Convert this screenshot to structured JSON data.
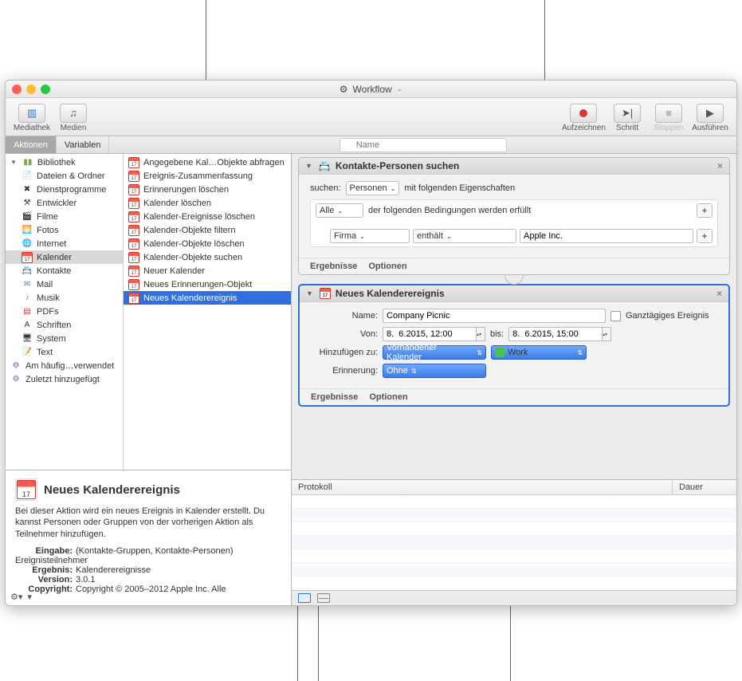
{
  "window": {
    "title": "Workflow"
  },
  "toolbar": {
    "mediathek": "Mediathek",
    "medien": "Medien",
    "aufzeichnen": "Aufzeichnen",
    "schritt": "Schritt",
    "stoppen": "Stoppen",
    "ausfuehren": "Ausführen"
  },
  "subtabs": {
    "aktionen": "Aktionen",
    "variablen": "Variablen",
    "search_placeholder": "Name"
  },
  "categories": {
    "bibliothek": "Bibliothek",
    "items": [
      "Dateien & Ordner",
      "Dienstprogramme",
      "Entwickler",
      "Filme",
      "Fotos",
      "Internet",
      "Kalender",
      "Kontakte",
      "Mail",
      "Musik",
      "PDFs",
      "Schriften",
      "System",
      "Text"
    ],
    "am_haeufig": "Am häufig…verwendet",
    "zuletzt": "Zuletzt hinzugefügt"
  },
  "actions": [
    "Angegebene Kal…Objekte abfragen",
    "Ereignis-Zusammenfassung",
    "Erinnerungen löschen",
    "Kalender löschen",
    "Kalender-Ereignisse löschen",
    "Kalender-Objekte filtern",
    "Kalender-Objekte löschen",
    "Kalender-Objekte suchen",
    "Neuer Kalender",
    "Neues Erinnerungen-Objekt",
    "Neues Kalenderereignis"
  ],
  "desc": {
    "title": "Neues Kalenderereignis",
    "text": "Bei dieser Aktion wird ein neues Ereignis in Kalender erstellt. Du kannst Personen oder Gruppen von der vorherigen Aktion als Teilnehmer hinzufügen.",
    "eingabe_label": "Eingabe:",
    "eingabe_value": "(Kontakte-Gruppen, Kontakte-Personen) Ereignisteilnehmer",
    "ergebnis_label": "Ergebnis:",
    "ergebnis_value": "Kalenderereignisse",
    "version_label": "Version:",
    "version_value": "3.0.1",
    "copyright_label": "Copyright:",
    "copyright_value": "Copyright © 2005–2012 Apple Inc. Alle"
  },
  "action1": {
    "title": "Kontakte-Personen suchen",
    "suchen": "suchen:",
    "personen": "Personen",
    "mit_folg": "mit folgenden Eigenschaften",
    "alle": "Alle",
    "der_folg": "der folgenden Bedingungen werden erfüllt",
    "firma": "Firma",
    "enthaelt": "enthält",
    "value": "Apple Inc.",
    "ergebnisse": "Ergebnisse",
    "optionen": "Optionen"
  },
  "action2": {
    "title": "Neues Kalenderereignis",
    "name_label": "Name:",
    "name_value": "Company Picnic",
    "ganztaegig": "Ganztägiges Ereignis",
    "von_label": "Von:",
    "von_value": "8.  6.2015, 12:00",
    "bis_label": "bis:",
    "bis_value": "8.  6.2015, 15:00",
    "hinzu_label": "Hinzufügen zu:",
    "hinzu_value": "Vorhandener Kalender",
    "work": "Work",
    "erinnerung_label": "Erinnerung:",
    "erinnerung_value": "Ohne",
    "ergebnisse": "Ergebnisse",
    "optionen": "Optionen"
  },
  "log": {
    "protokoll": "Protokoll",
    "dauer": "Dauer"
  }
}
